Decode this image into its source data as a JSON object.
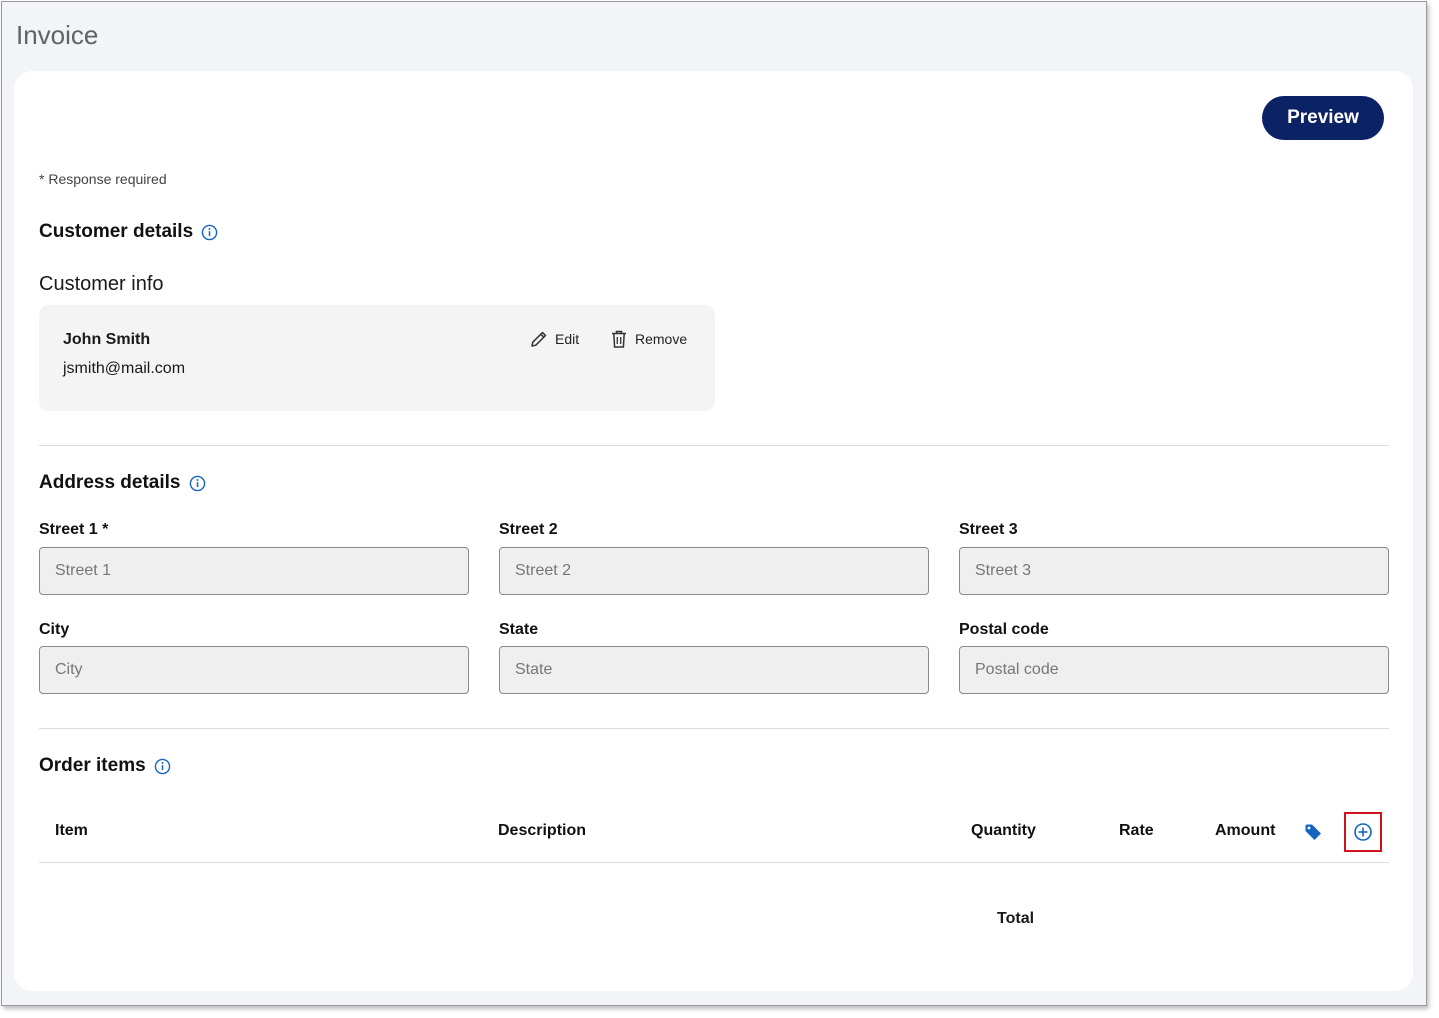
{
  "page": {
    "title": "Invoice"
  },
  "toolbar": {
    "preview_label": "Preview"
  },
  "form": {
    "required_note": "* Response required"
  },
  "customer": {
    "section_title": "Customer details",
    "info_title": "Customer info",
    "name": "John Smith",
    "email": "jsmith@mail.com",
    "edit_label": "Edit",
    "remove_label": "Remove"
  },
  "address": {
    "section_title": "Address details",
    "fields": {
      "street1": {
        "label": "Street 1 *",
        "placeholder": "Street 1",
        "value": ""
      },
      "street2": {
        "label": "Street 2",
        "placeholder": "Street 2",
        "value": ""
      },
      "street3": {
        "label": "Street 3",
        "placeholder": "Street 3",
        "value": ""
      },
      "city": {
        "label": "City",
        "placeholder": "City",
        "value": ""
      },
      "state": {
        "label": "State",
        "placeholder": "State",
        "value": ""
      },
      "postal": {
        "label": "Postal code",
        "placeholder": "Postal code",
        "value": ""
      }
    }
  },
  "order": {
    "section_title": "Order items",
    "columns": {
      "item": "Item",
      "description": "Description",
      "quantity": "Quantity",
      "rate": "Rate",
      "amount": "Amount"
    },
    "total_label": "Total"
  },
  "icons": {
    "info": "info-circle-icon",
    "edit": "pencil-icon",
    "remove": "trash-icon",
    "tag": "tag-icon",
    "add": "plus-circle-icon"
  },
  "colors": {
    "brand": "#0b2265",
    "accent_blue": "#1565c0",
    "highlight_red": "#d0121b",
    "page_bg": "#f3f4f7"
  }
}
